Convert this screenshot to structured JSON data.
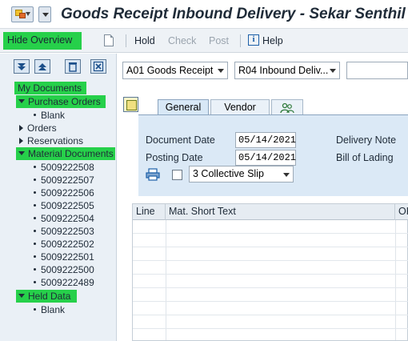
{
  "window": {
    "title": "Goods Receipt Inbound Delivery - Sekar Senthil"
  },
  "toolbar": {
    "hide_overview": "Hide Overview",
    "hold": "Hold",
    "check": "Check",
    "post": "Post",
    "help": "Help"
  },
  "tree": {
    "my_documents": "My Documents",
    "purchase_orders": "Purchase Orders",
    "po_blank": "Blank",
    "orders": "Orders",
    "reservations": "Reservations",
    "material_documents": "Material Documents",
    "mat_docs": [
      "5009222508",
      "5009222507",
      "5009222506",
      "5009222505",
      "5009222504",
      "5009222503",
      "5009222502",
      "5009222501",
      "5009222500",
      "5009222489"
    ],
    "held_data": "Held Data",
    "held_blank": "Blank"
  },
  "header": {
    "transaction": "A01 Goods Receipt",
    "reference": "R04 Inbound Deliv..."
  },
  "tabs": {
    "general": "General",
    "vendor": "Vendor"
  },
  "general": {
    "document_date_label": "Document Date",
    "document_date": "05/14/2021",
    "posting_date_label": "Posting Date",
    "posting_date": "05/14/2021",
    "delivery_note_label": "Delivery Note",
    "bill_of_lading_label": "Bill of Lading",
    "slip_option": "3 Collective Slip"
  },
  "table": {
    "columns": [
      "Line",
      "Mat. Short Text",
      "OK"
    ]
  },
  "colors": {
    "highlight": "#26d04a",
    "panel": "#dbe9f6",
    "left_panel": "#eaf0f6"
  }
}
